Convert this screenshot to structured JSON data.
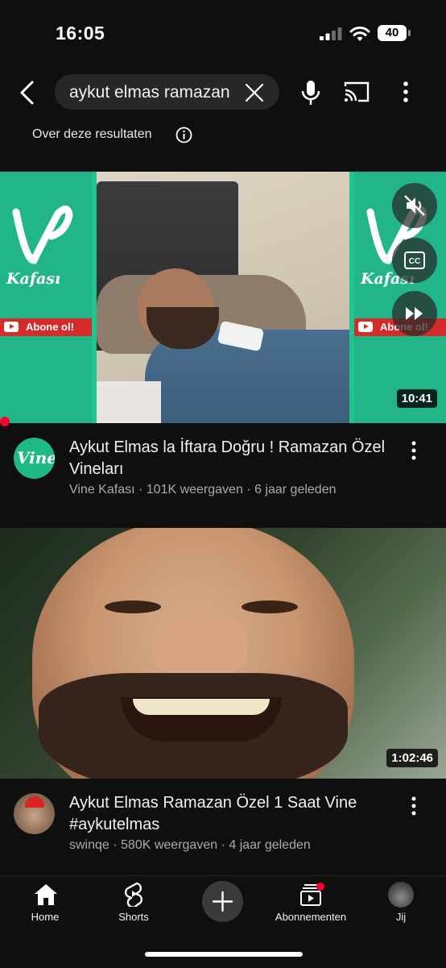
{
  "status": {
    "time": "16:05",
    "battery": "40"
  },
  "search": {
    "query": "aykut elmas ramazan"
  },
  "about_results": "Over deze resultaten",
  "videos": [
    {
      "title": "Aykut Elmas la İftara Doğru ! Ramazan Özel Vineları",
      "channel": "Vine Kafası",
      "views": "101K weergaven",
      "age": "6 jaar geleden",
      "duration": "10:41",
      "thumb_brand": "Vine",
      "thumb_brand2": "Kafası",
      "thumb_cta": "Abone ol!",
      "avatar_text": "Vine"
    },
    {
      "title": "Aykut Elmas Ramazan Özel 1 Saat Vine #aykutelmas",
      "channel": "swinqe",
      "views": "580K weergaven",
      "age": "4 jaar geleden",
      "duration": "1:02:46"
    }
  ],
  "meta_sep": " · ",
  "nav": {
    "home": "Home",
    "shorts": "Shorts",
    "subscriptions": "Abonnementen",
    "you": "Jij"
  },
  "colors": {
    "background": "#0f0f0f",
    "accent_red": "#ff0033",
    "vine_green": "#1ec58c"
  }
}
